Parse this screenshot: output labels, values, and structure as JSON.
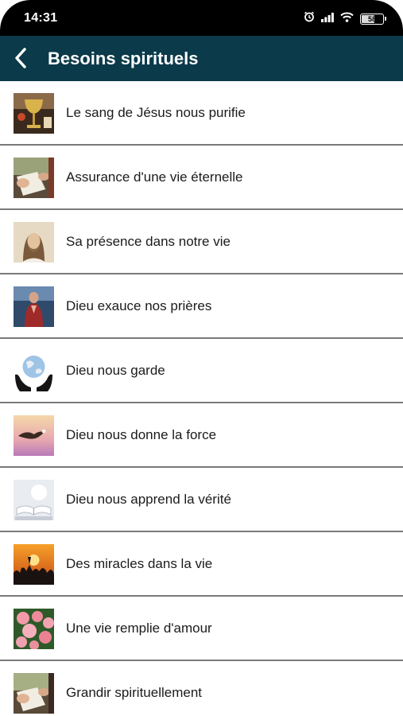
{
  "status_bar": {
    "time": "14:31",
    "battery_level": "58",
    "icons": [
      "alarm-icon",
      "signal-icon",
      "wifi-icon",
      "battery-icon"
    ]
  },
  "app_bar": {
    "title": "Besoins spirituels",
    "back_icon": "chevron-left-icon"
  },
  "colors": {
    "app_bar": "#0b3a4a",
    "divider": "#7a7a7a",
    "text": "#1b1b1b"
  },
  "items": [
    {
      "label": "Le sang de Jésus nous purifie",
      "image": "chalice-image"
    },
    {
      "label": "Assurance d'une vie éternelle",
      "image": "hands-bible-image"
    },
    {
      "label": "Sa présence dans notre vie",
      "image": "jesus-portrait-image"
    },
    {
      "label": "Dieu exauce nos prières",
      "image": "praying-woman-image"
    },
    {
      "label": "Dieu nous garde",
      "image": "globe-in-hands-image"
    },
    {
      "label": "Dieu nous donne la force",
      "image": "eagle-sunset-image"
    },
    {
      "label": "Dieu nous apprend la vérité",
      "image": "open-book-image"
    },
    {
      "label": "Des miracles dans la vie",
      "image": "sunset-crowd-image"
    },
    {
      "label": "Une vie remplie d'amour",
      "image": "roses-image"
    },
    {
      "label": "Grandir spirituellement",
      "image": "hands-bible-image"
    }
  ]
}
